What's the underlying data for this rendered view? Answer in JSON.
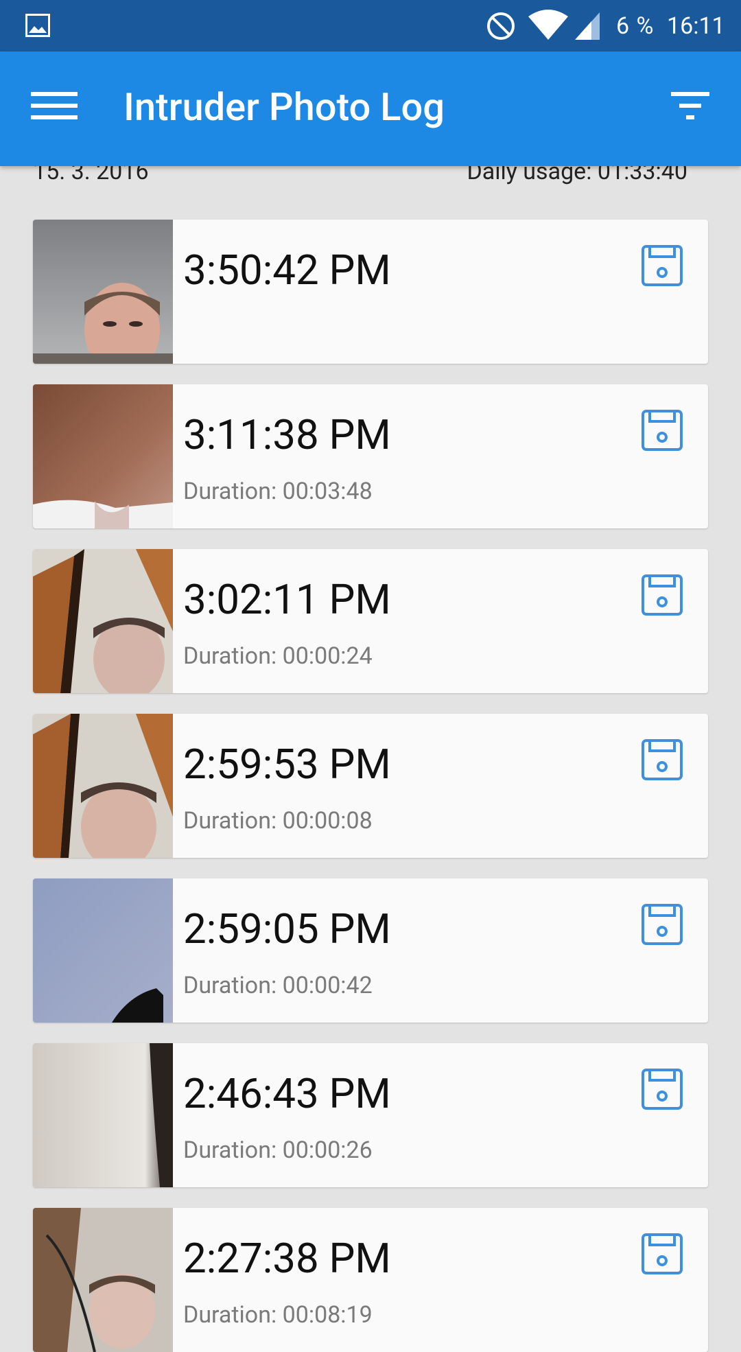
{
  "status_bar": {
    "battery": "6 %",
    "time": "16:11",
    "icons": [
      "image-notification-icon",
      "do-not-disturb-icon",
      "wifi-icon",
      "cell-signal-icon"
    ]
  },
  "app_bar": {
    "title": "Intruder Photo Log",
    "menu_icon": "hamburger-menu-icon",
    "filter_icon": "filter-icon",
    "color": "#1e88e5"
  },
  "summary": {
    "date": "15. 3. 2016",
    "daily_usage": "Daily usage: 01:33:40"
  },
  "entries": [
    {
      "time": "3:50:42 PM",
      "duration": ""
    },
    {
      "time": "3:11:38 PM",
      "duration": "Duration: 00:03:48"
    },
    {
      "time": "3:02:11 PM",
      "duration": "Duration: 00:00:24"
    },
    {
      "time": "2:59:53 PM",
      "duration": "Duration: 00:00:08"
    },
    {
      "time": "2:59:05 PM",
      "duration": "Duration: 00:00:42"
    },
    {
      "time": "2:46:43 PM",
      "duration": "Duration: 00:00:26"
    },
    {
      "time": "2:27:38 PM",
      "duration": "Duration: 00:08:19"
    }
  ],
  "colors": {
    "status_bar": "#1a5a9c",
    "accent_icon": "#3d8fe0",
    "background": "#e3e3e3"
  }
}
